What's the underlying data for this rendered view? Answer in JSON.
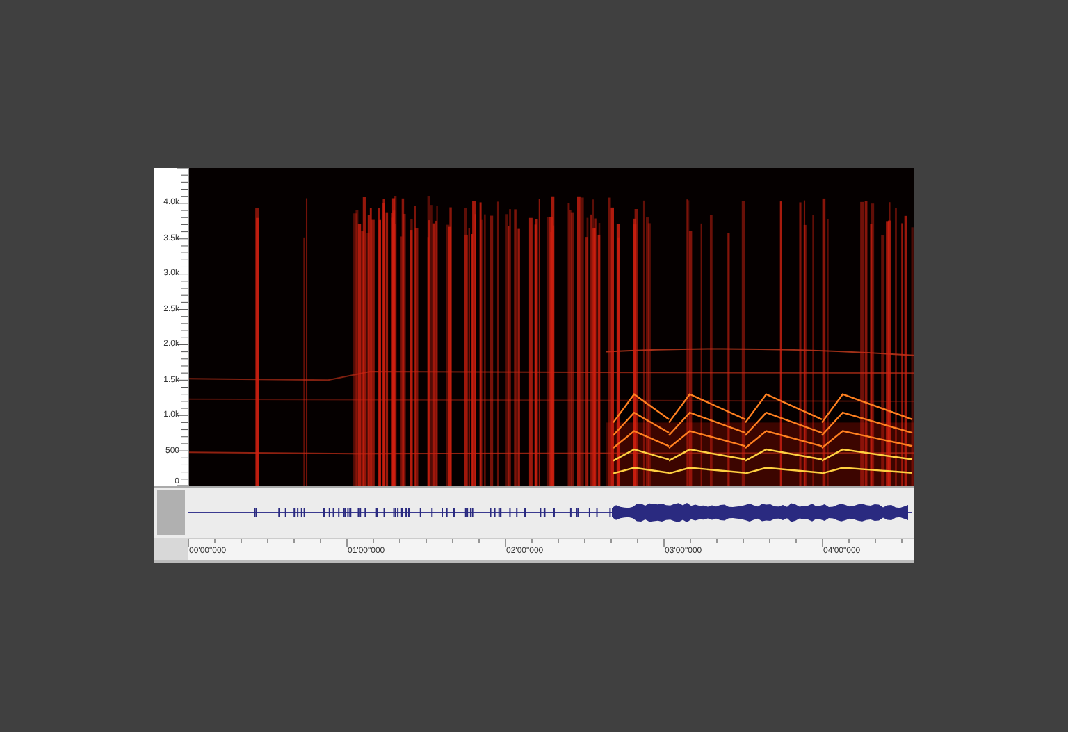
{
  "frequency_axis": {
    "labels": [
      "4.0k",
      "3.5k",
      "3.0k",
      "2.5k",
      "2.0k",
      "1.5k",
      "1.0k",
      "500",
      "0"
    ]
  },
  "time_axis": {
    "labels": [
      "00'00\"000",
      "01'00\"000",
      "02'00\"000",
      "03'00\"000",
      "04'00\"000"
    ]
  }
}
